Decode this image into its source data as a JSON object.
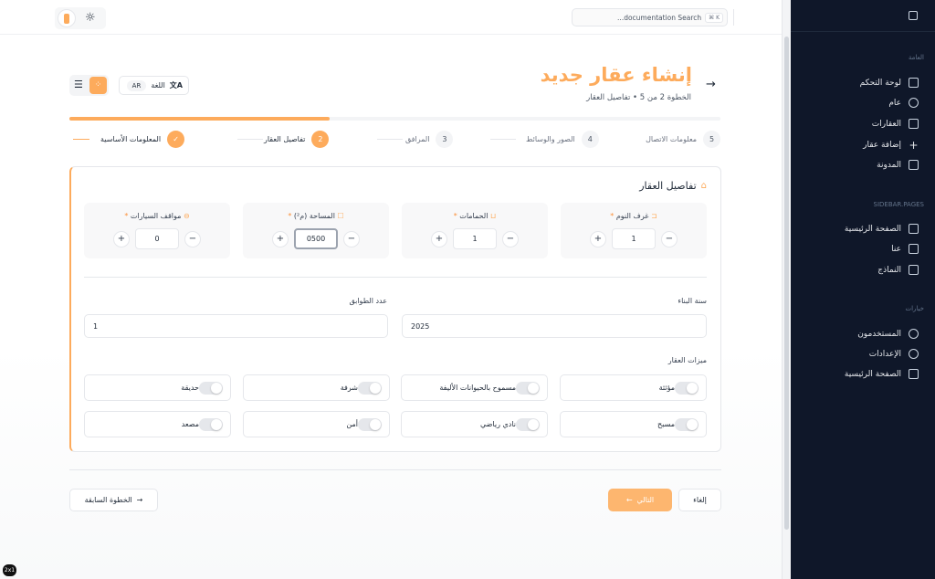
{
  "topbar": {
    "search_placeholder": "...documentation Search",
    "shortcut": "⌘ K"
  },
  "header": {
    "title": "إنشاء عقار جديد",
    "subtitle": "الخطوة 2 من 5 • تفاصيل العقار",
    "language_label": "اللغة",
    "language_code": "AR"
  },
  "progress": {
    "percent": 40
  },
  "steps": [
    {
      "num": "5",
      "label": "معلومات الاتصال"
    },
    {
      "num": "4",
      "label": "الصور والوسائط"
    },
    {
      "num": "3",
      "label": "المرافق"
    },
    {
      "num": "2",
      "label": "تفاصيل العقار"
    },
    {
      "num": "✓",
      "label": "المعلومات الأساسية"
    }
  ],
  "card": {
    "title": "تفاصيل العقار",
    "counters": [
      {
        "label": "غرف النوم",
        "value": "1"
      },
      {
        "label": "الحمامات",
        "value": "1"
      },
      {
        "label": "المساحة (م²)",
        "value": "0500"
      },
      {
        "label": "مواقف السيارات",
        "value": "0"
      }
    ],
    "year_label": "سنة البناء",
    "year_value": "2025",
    "floors_label": "عدد الطوابق",
    "floors_value": "1",
    "features_label": "ميزات العقار",
    "features": [
      "مؤثثة",
      "مسموح بالحيوانات الأليفة",
      "شرفة",
      "حديقة",
      "مسبح",
      "نادي رياضي",
      "أمن",
      "مصعد"
    ]
  },
  "footer": {
    "cancel": "إلغاء",
    "next": "التالي",
    "prev": "الخطوة السابقة"
  },
  "sidebar": {
    "section1": "العامة",
    "items1": [
      "لوحة التحكم",
      "عام",
      "العقارات",
      "إضافة عقار",
      "المدونة"
    ],
    "section2": "SIDEBAR.PAGES",
    "items2": [
      "الصفحة الرئيسية",
      "عنا",
      "النماذج"
    ],
    "section3": "خيارات",
    "items3": [
      "المستخدمون",
      "الإعدادات",
      "الصفحة الرئيسية"
    ]
  },
  "badge": "2x1",
  "colors": {
    "accent": "#fdab5c",
    "sidebar": "#0f1729"
  }
}
